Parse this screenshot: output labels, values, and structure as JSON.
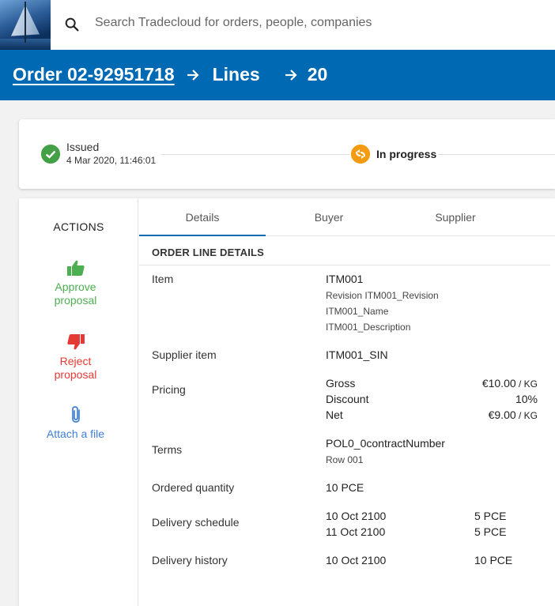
{
  "search": {
    "placeholder": "Search Tradecloud for orders, people, companies"
  },
  "breadcrumb": {
    "order": "Order 02-92951718",
    "lines": "Lines",
    "line_number": "20"
  },
  "status": {
    "issued_label": "Issued",
    "issued_date": "4 Mar 2020, 11:46:01",
    "progress_label": "In progress",
    "colors": {
      "issued": "#43a047",
      "progress": "#f39c12"
    }
  },
  "actions": {
    "title": "ACTIONS",
    "approve": {
      "line1": "Approve",
      "line2": "proposal",
      "icon": "thumbs-up-icon",
      "color": "#4caf50"
    },
    "reject": {
      "line1": "Reject",
      "line2": "proposal",
      "icon": "thumbs-down-icon",
      "color": "#e53935"
    },
    "attach": {
      "label": "Attach a file",
      "icon": "paperclip-icon",
      "color": "#3f7fd8"
    }
  },
  "tabs": [
    "Details",
    "Buyer",
    "Supplier"
  ],
  "details": {
    "section_title": "ORDER LINE DETAILS",
    "item": {
      "label": "Item",
      "code": "ITM001",
      "revision": "Revision ITM001_Revision",
      "name": "ITM001_Name",
      "description": "ITM001_Description"
    },
    "supplier_item": {
      "label": "Supplier item",
      "value": "ITM001_SIN"
    },
    "pricing": {
      "label": "Pricing",
      "gross_label": "Gross",
      "gross_value": "€10.00",
      "gross_unit": " / KG",
      "discount_label": "Discount",
      "discount_value": "10%",
      "net_label": "Net",
      "net_value": "€9.00",
      "net_unit": " / KG"
    },
    "terms": {
      "label": "Terms",
      "contract": "POL0_0contractNumber",
      "row": "Row 001"
    },
    "ordered_quantity": {
      "label": "Ordered quantity",
      "value": "10 PCE"
    },
    "delivery_schedule": {
      "label": "Delivery schedule",
      "rows": [
        {
          "date": "10 Oct 2100",
          "qty": "5 PCE"
        },
        {
          "date": "11 Oct 2100",
          "qty": "5 PCE"
        }
      ]
    },
    "delivery_history": {
      "label": "Delivery history",
      "rows": [
        {
          "date": "10 Oct 2100",
          "qty": "10 PCE"
        }
      ]
    }
  },
  "theme": {
    "header_bg": "#0069b4"
  }
}
